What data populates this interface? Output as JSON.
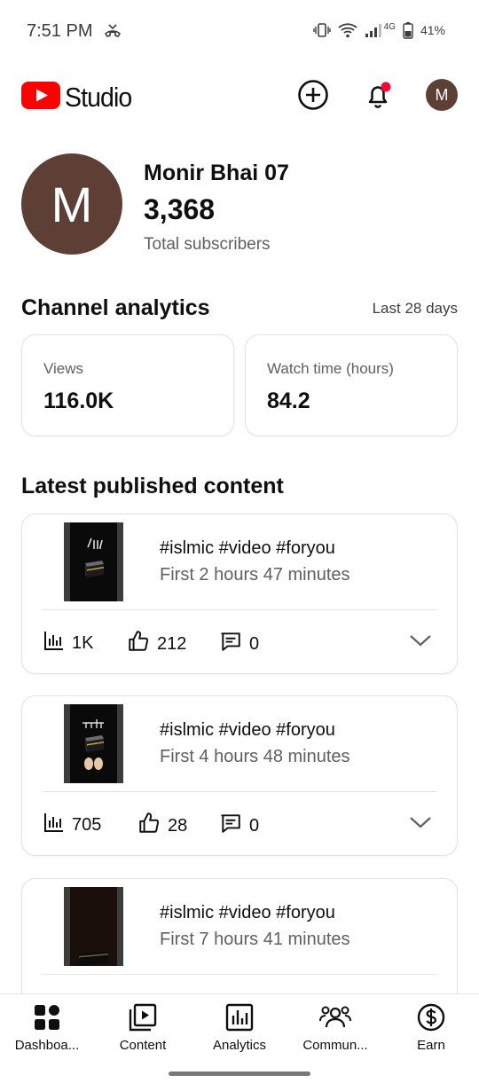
{
  "status_bar": {
    "time": "7:51 PM",
    "network": "4G",
    "battery": "41%"
  },
  "header": {
    "app_name": "Studio",
    "avatar_letter": "M",
    "brand_color": "#ff0000",
    "notification_dot_color": "#ff0033"
  },
  "channel": {
    "avatar_letter": "M",
    "name": "Monir Bhai 07",
    "subscribers": "3,368",
    "subscribers_label": "Total subscribers"
  },
  "analytics": {
    "title": "Channel analytics",
    "period": "Last 28 days",
    "metrics": [
      {
        "label": "Views",
        "value": "116.0K"
      },
      {
        "label": "Watch time (hours)",
        "value": "84.2"
      }
    ]
  },
  "latest": {
    "title": "Latest published content",
    "items": [
      {
        "title": "#islmic #video #foryou",
        "age": "First 2 hours 47 minutes",
        "views": "1K",
        "likes": "212",
        "comments": "0"
      },
      {
        "title": "#islmic #video #foryou",
        "age": "First 4 hours 48 minutes",
        "views": "705",
        "likes": "28",
        "comments": "0"
      },
      {
        "title": "#islmic #video #foryou",
        "age": "First 7 hours 41 minutes"
      }
    ]
  },
  "bottom_nav": {
    "items": [
      {
        "label": "Dashboa...",
        "icon": "dashboard-icon"
      },
      {
        "label": "Content",
        "icon": "content-icon"
      },
      {
        "label": "Analytics",
        "icon": "analytics-icon"
      },
      {
        "label": "Commun...",
        "icon": "community-icon"
      },
      {
        "label": "Earn",
        "icon": "earn-icon"
      }
    ]
  }
}
